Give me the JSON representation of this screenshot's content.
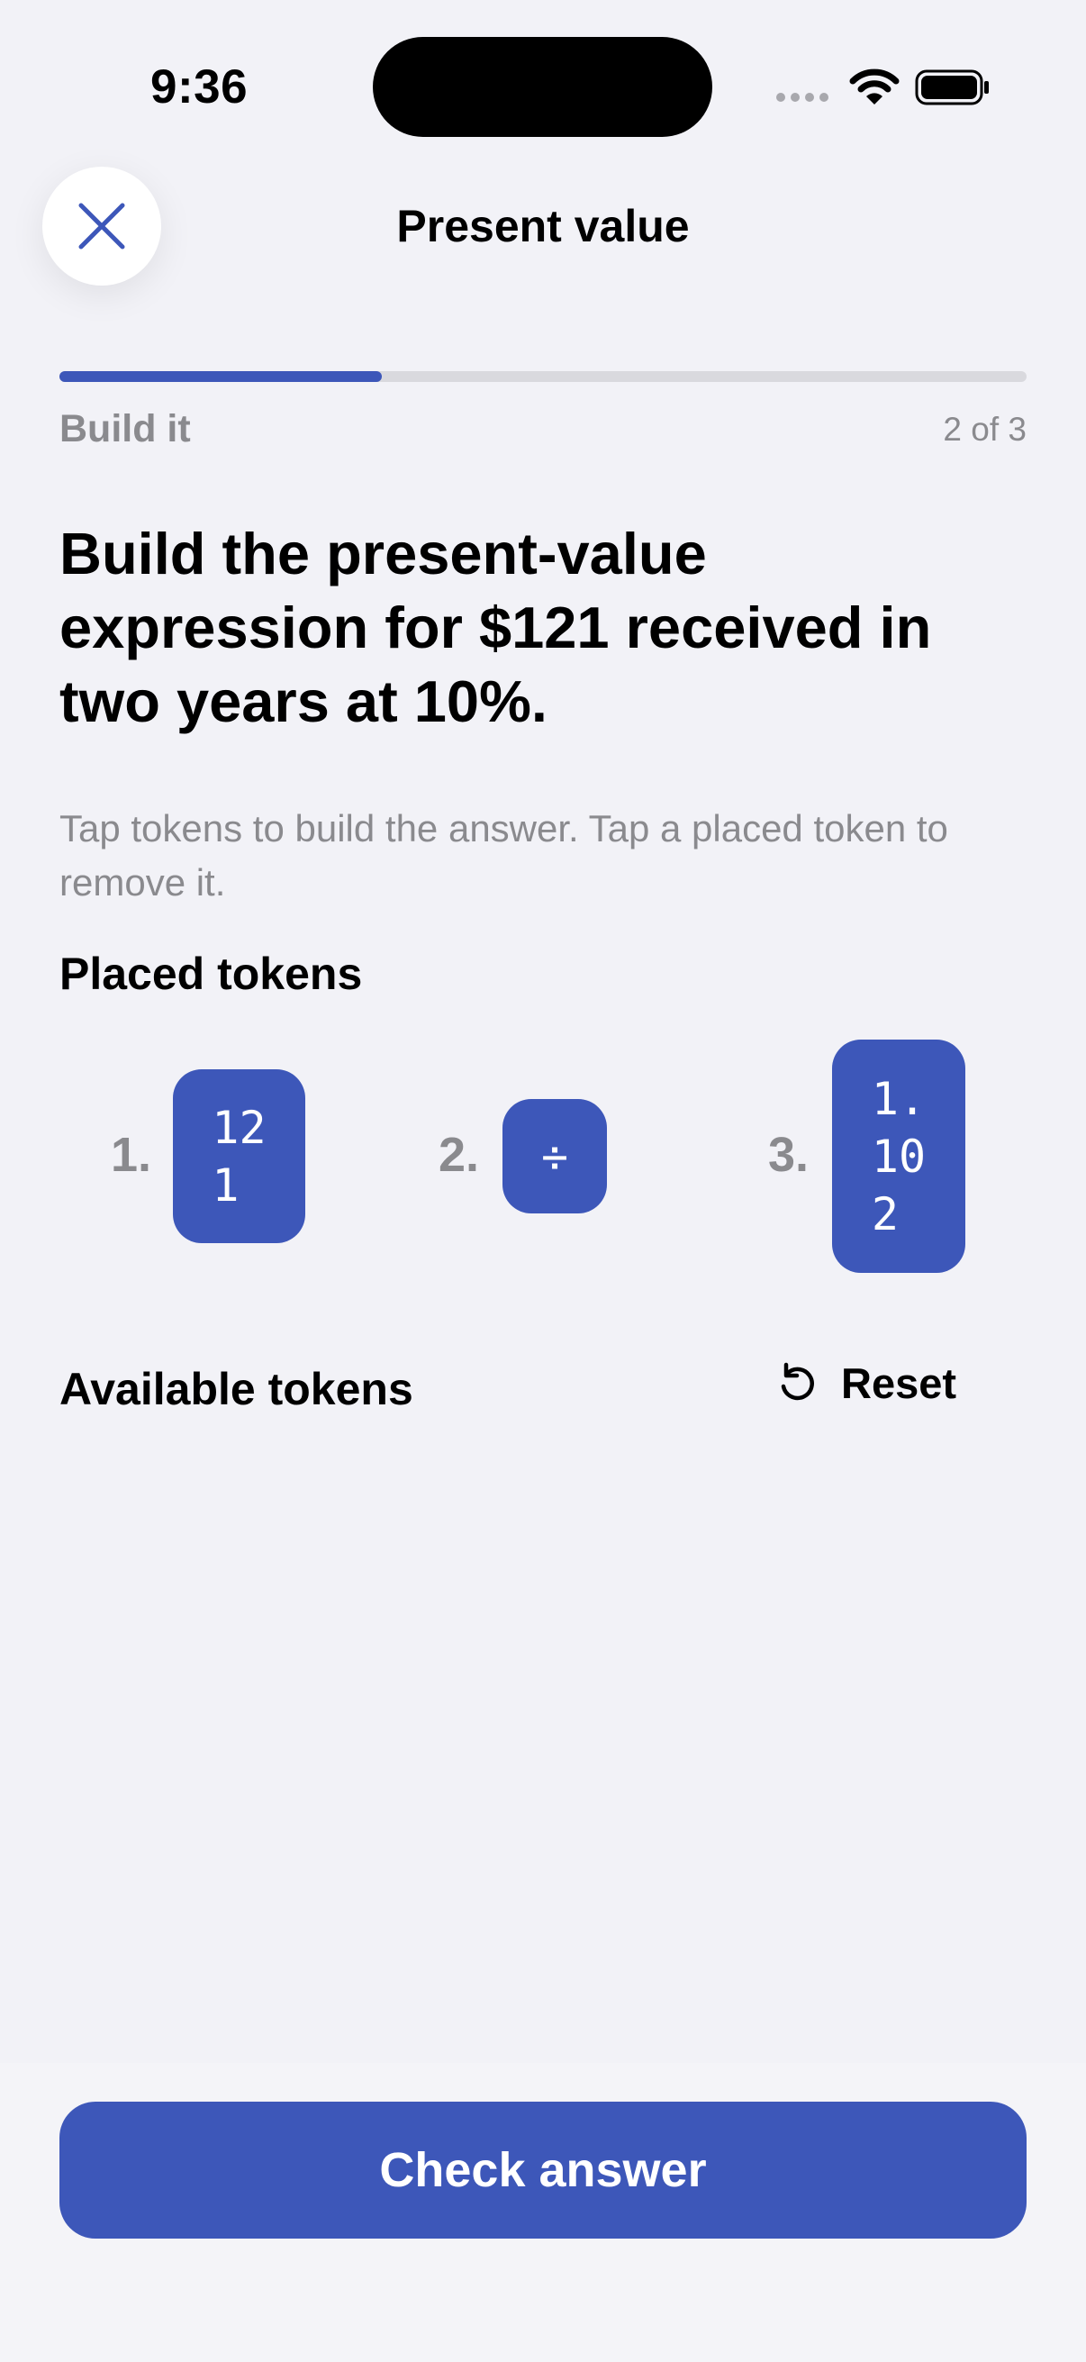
{
  "status_bar": {
    "time": "9:36",
    "icons": [
      "signal-dots-icon",
      "wifi-icon",
      "battery-icon"
    ]
  },
  "header": {
    "title": "Present value",
    "close_icon": "close-icon"
  },
  "progress": {
    "label": "Build it",
    "count": "2 of 3",
    "fraction": 0.333
  },
  "question": "Build the present-value expression for $121 received in two years at 10%.",
  "instructions": "Tap tokens to build the answer. Tap a placed token to remove it.",
  "placed": {
    "heading": "Placed tokens",
    "tokens": [
      {
        "number": "1.",
        "value": "12\n1"
      },
      {
        "number": "2.",
        "value": "÷"
      },
      {
        "number": "3.",
        "value": "1.\n10\n2"
      }
    ]
  },
  "available": {
    "heading": "Available tokens",
    "reset_label": "Reset",
    "reset_icon": "reset-icon"
  },
  "footer": {
    "check_label": "Check answer"
  },
  "colors": {
    "accent": "#3d57b9",
    "background": "#f2f2f7",
    "secondary_text": "#8a8a8e"
  }
}
